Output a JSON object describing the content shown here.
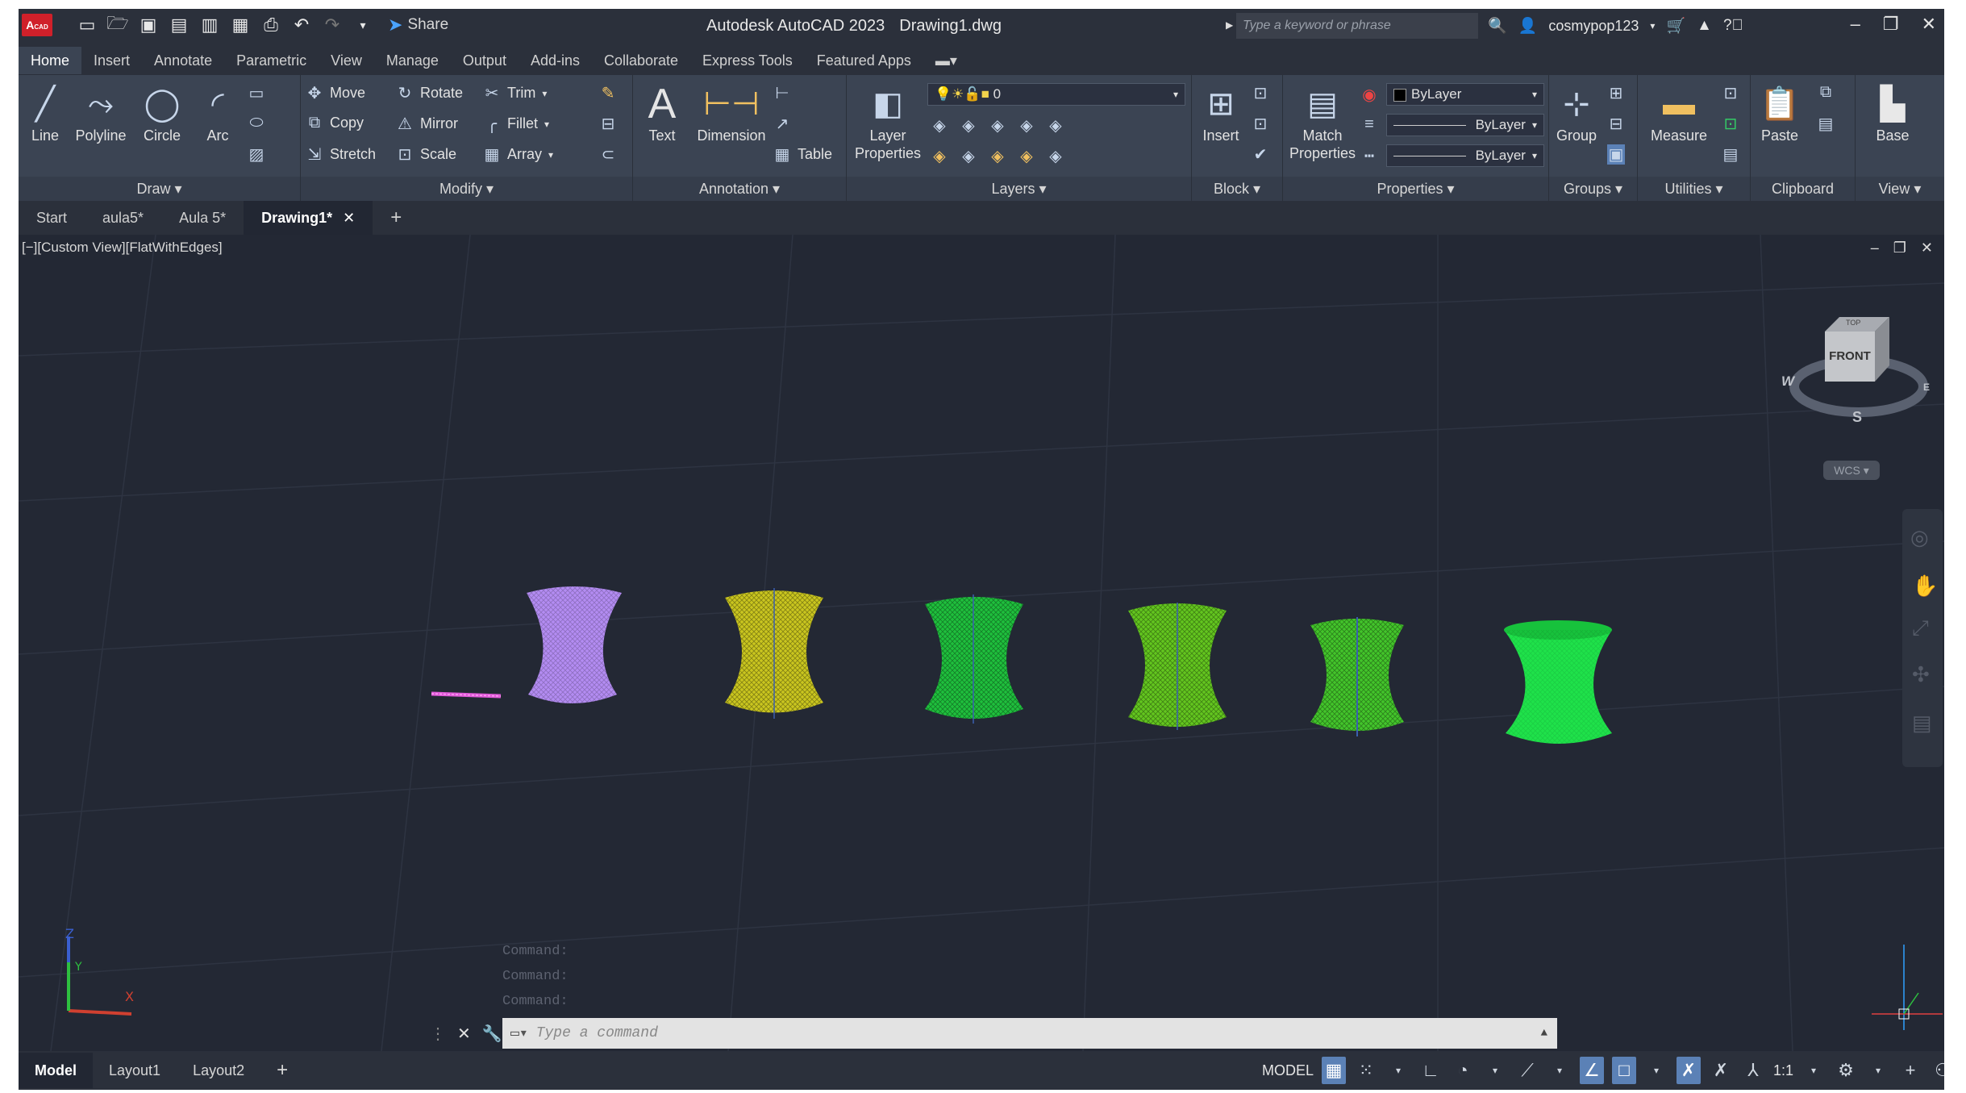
{
  "titlebar": {
    "app": "Autodesk AutoCAD 2023",
    "file": "Drawing1.dwg",
    "share": "Share",
    "search_placeholder": "Type a keyword or phrase",
    "user": "cosmypop123",
    "logo": "A",
    "logo_sub": "CAD"
  },
  "ribbon_tabs": [
    "Home",
    "Insert",
    "Annotate",
    "Parametric",
    "View",
    "Manage",
    "Output",
    "Add-ins",
    "Collaborate",
    "Express Tools",
    "Featured Apps"
  ],
  "draw": {
    "title": "Draw",
    "line": "Line",
    "polyline": "Polyline",
    "circle": "Circle",
    "arc": "Arc"
  },
  "modify": {
    "title": "Modify",
    "move": "Move",
    "rotate": "Rotate",
    "trim": "Trim",
    "copy": "Copy",
    "mirror": "Mirror",
    "fillet": "Fillet",
    "stretch": "Stretch",
    "scale": "Scale",
    "array": "Array"
  },
  "annotation": {
    "title": "Annotation",
    "text": "Text",
    "dimension": "Dimension",
    "table": "Table"
  },
  "layers": {
    "title": "Layers",
    "layer_properties_1": "Layer",
    "layer_properties_2": "Properties",
    "current_layer": "0"
  },
  "block": {
    "title": "Block",
    "insert": "Insert"
  },
  "properties": {
    "title": "Properties",
    "match_1": "Match",
    "match_2": "Properties",
    "color": "ByLayer",
    "linetype": "ByLayer",
    "lineweight": "ByLayer"
  },
  "groups": {
    "title": "Groups",
    "group": "Group"
  },
  "utilities": {
    "title": "Utilities",
    "measure": "Measure"
  },
  "clipboard": {
    "title": "Clipboard",
    "paste": "Paste"
  },
  "view": {
    "title": "View",
    "base": "Base"
  },
  "doc_tabs": [
    "Start",
    "aula5*",
    "Aula 5*",
    "Drawing1*"
  ],
  "viewport": {
    "label": "[−][Custom View][FlatWithEdges]",
    "viewcube_face": "FRONT",
    "viewcube_top": "TOP",
    "compass_w": "W",
    "compass_s": "S",
    "compass_e": "E",
    "wcs": "WCS"
  },
  "command": {
    "history": [
      "Command:",
      "Command:",
      "Command:"
    ],
    "placeholder": "Type a command"
  },
  "layout_tabs": [
    "Model",
    "Layout1",
    "Layout2"
  ],
  "status": {
    "model": "MODEL",
    "scale": "1:1"
  },
  "colors": {
    "purple": "#b38cf2",
    "yellow": "#e8e21c",
    "green": "#1fe24a",
    "accent": "#5b81b6"
  }
}
